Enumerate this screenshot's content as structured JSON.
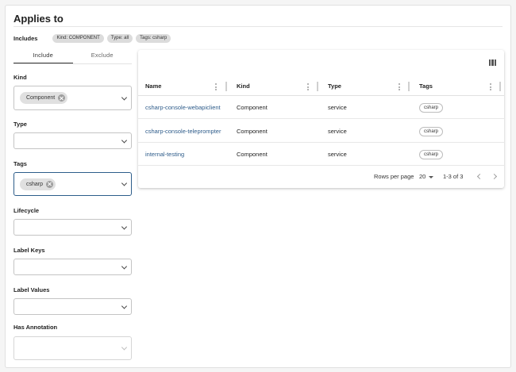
{
  "title": "Applies to",
  "includes": {
    "label": "Includes",
    "chips": [
      "Kind: COMPONENT",
      "Type: all",
      "Tags: csharp"
    ]
  },
  "tabs": [
    {
      "label": "Include",
      "active": true
    },
    {
      "label": "Exclude",
      "active": false
    }
  ],
  "filters": {
    "kind": {
      "label": "Kind",
      "chip": "Component"
    },
    "type": {
      "label": "Type"
    },
    "tags": {
      "label": "Tags",
      "chip": "csharp"
    },
    "lifecycle": {
      "label": "Lifecycle"
    },
    "label_keys": {
      "label": "Label Keys"
    },
    "label_values": {
      "label": "Label Values"
    },
    "has_annotation": {
      "label": "Has Annotation"
    }
  },
  "table": {
    "columns": [
      "Name",
      "Kind",
      "Type",
      "Tags"
    ],
    "rows": [
      {
        "name": "csharp-console-webapiclient",
        "kind": "Component",
        "type": "service",
        "tag": "csharp"
      },
      {
        "name": "csharp-console-teleprompter",
        "kind": "Component",
        "type": "service",
        "tag": "csharp"
      },
      {
        "name": "internal-testing",
        "kind": "Component",
        "type": "service",
        "tag": "csharp"
      }
    ],
    "footer": {
      "rows_per_page_label": "Rows per page",
      "rows_per_page": "20",
      "range": "1-3 of 3"
    }
  },
  "icons": {
    "columns": "view-column-icon",
    "chip_remove": "cancel-circle-icon",
    "dropdown": "chevron-down-icon",
    "prev": "chevron-left-icon",
    "next": "chevron-right-icon"
  },
  "colors": {
    "link": "#2e5c8a",
    "focus_border": "#2d5d8a",
    "chip_bg": "#e0e0e0"
  }
}
